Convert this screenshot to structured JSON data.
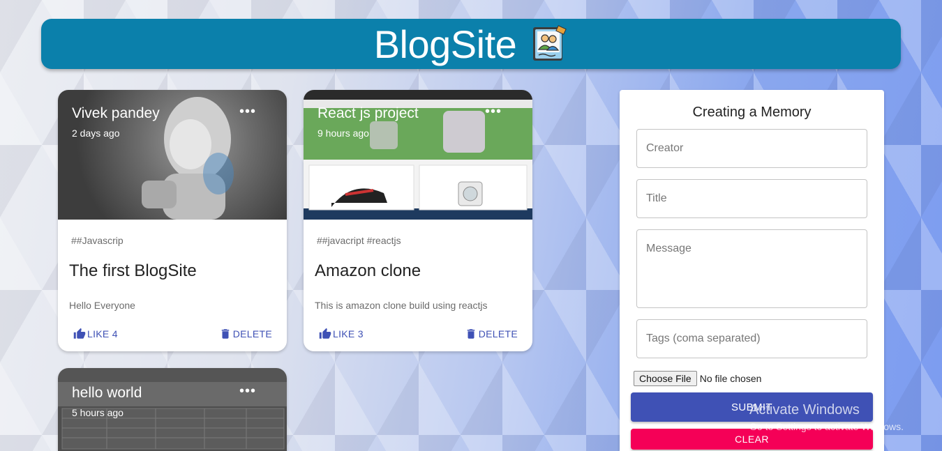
{
  "header": {
    "title": "BlogSite",
    "logo_icon": "photo-album-icon"
  },
  "posts": [
    {
      "creator": "Vivek pandey",
      "time": "2 days ago",
      "tags": "##Javascrip",
      "title": "The first BlogSite",
      "message": "Hello Everyone",
      "like_label": "LIKE 4",
      "delete_label": "DELETE"
    },
    {
      "creator": "React js project",
      "time": "9 hours ago",
      "tags": "##javacript #reactjs",
      "title": "Amazon clone",
      "message": "This is amazon clone build using reactjs",
      "like_label": "LIKE 3",
      "delete_label": "DELETE"
    },
    {
      "creator": "hello world",
      "time": "5 hours ago"
    }
  ],
  "form": {
    "heading": "Creating a Memory",
    "creator_placeholder": "Creator",
    "title_placeholder": "Title",
    "message_placeholder": "Message",
    "tags_placeholder": "Tags (coma separated)",
    "choose_file_label": "Choose File",
    "no_file_text": "No file chosen",
    "submit_label": "SUBMIT",
    "clear_label": "CLEAR"
  },
  "watermark": {
    "line1": "Activate Windows",
    "line2": "Go to Settings to activate Windows."
  },
  "colors": {
    "appbar": "#0b80ab",
    "primary": "#3f51b5",
    "secondary": "#f50057"
  }
}
